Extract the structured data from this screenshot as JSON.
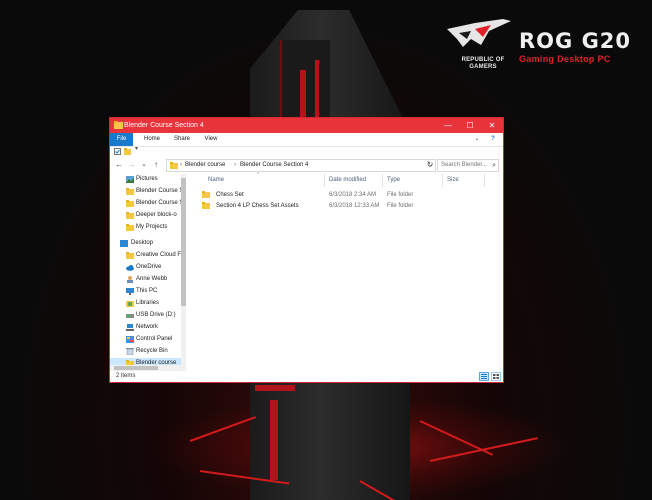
{
  "wallpaper": {
    "brand_name": "ROG G20",
    "brand_tagline": "Gaming Desktop PC",
    "brand_sub": "REPUBLIC OF GAMERS",
    "accent": "#e02028"
  },
  "window": {
    "title": "Blender Course Section 4",
    "title_color": "#e8333b",
    "controls": {
      "minimize": "—",
      "maximize": "☐",
      "close": "✕"
    },
    "ribbon": {
      "tabs": [
        "File",
        "Home",
        "Share",
        "View"
      ],
      "collapse_icon": "chevron-down-icon",
      "help_label": "?"
    },
    "nav": {
      "back": "←",
      "forward": "→",
      "recent": "⌄",
      "up": "↑",
      "refresh": "↻"
    },
    "address": {
      "root_sep": "›",
      "crumbs": [
        "Blender course",
        "Blender Course Section 4"
      ],
      "dropdown": "⌄"
    },
    "search": {
      "placeholder": "Search Blender...",
      "icon": "search-icon"
    },
    "sidebar": {
      "items": [
        {
          "label": "Pictures",
          "icon": "pictures-icon"
        },
        {
          "label": "Blender Course S",
          "icon": "folder-icon"
        },
        {
          "label": "Blender Course S",
          "icon": "folder-icon"
        },
        {
          "label": "Deeper block-o",
          "icon": "folder-icon"
        },
        {
          "label": "My Projects",
          "icon": "folder-icon"
        },
        {
          "label": "Desktop",
          "icon": "desktop-icon"
        },
        {
          "label": "Creative Cloud F",
          "icon": "creative-cloud-icon"
        },
        {
          "label": "OneDrive",
          "icon": "onedrive-icon"
        },
        {
          "label": "Anne Webb",
          "icon": "user-icon"
        },
        {
          "label": "This PC",
          "icon": "this-pc-icon"
        },
        {
          "label": "Libraries",
          "icon": "libraries-icon"
        },
        {
          "label": "USB Drive (D:)",
          "icon": "usb-drive-icon"
        },
        {
          "label": "Network",
          "icon": "network-icon"
        },
        {
          "label": "Control Panel",
          "icon": "control-panel-icon"
        },
        {
          "label": "Recycle Bin",
          "icon": "recycle-bin-icon"
        },
        {
          "label": "Blender course",
          "icon": "folder-icon",
          "selected": true
        }
      ]
    },
    "columns": [
      "Name",
      "Date modified",
      "Type",
      "Size"
    ],
    "files": [
      {
        "name": "Chess Set",
        "date": "6/3/2018 2:34 AM",
        "type": "File folder",
        "size": ""
      },
      {
        "name": "Section 4 LP Chess Set Assets",
        "date": "6/3/2018 12:33 AM",
        "type": "File folder",
        "size": ""
      }
    ],
    "status": {
      "item_count": "2 items"
    },
    "views": [
      "details-view-icon",
      "large-icons-view-icon"
    ]
  }
}
